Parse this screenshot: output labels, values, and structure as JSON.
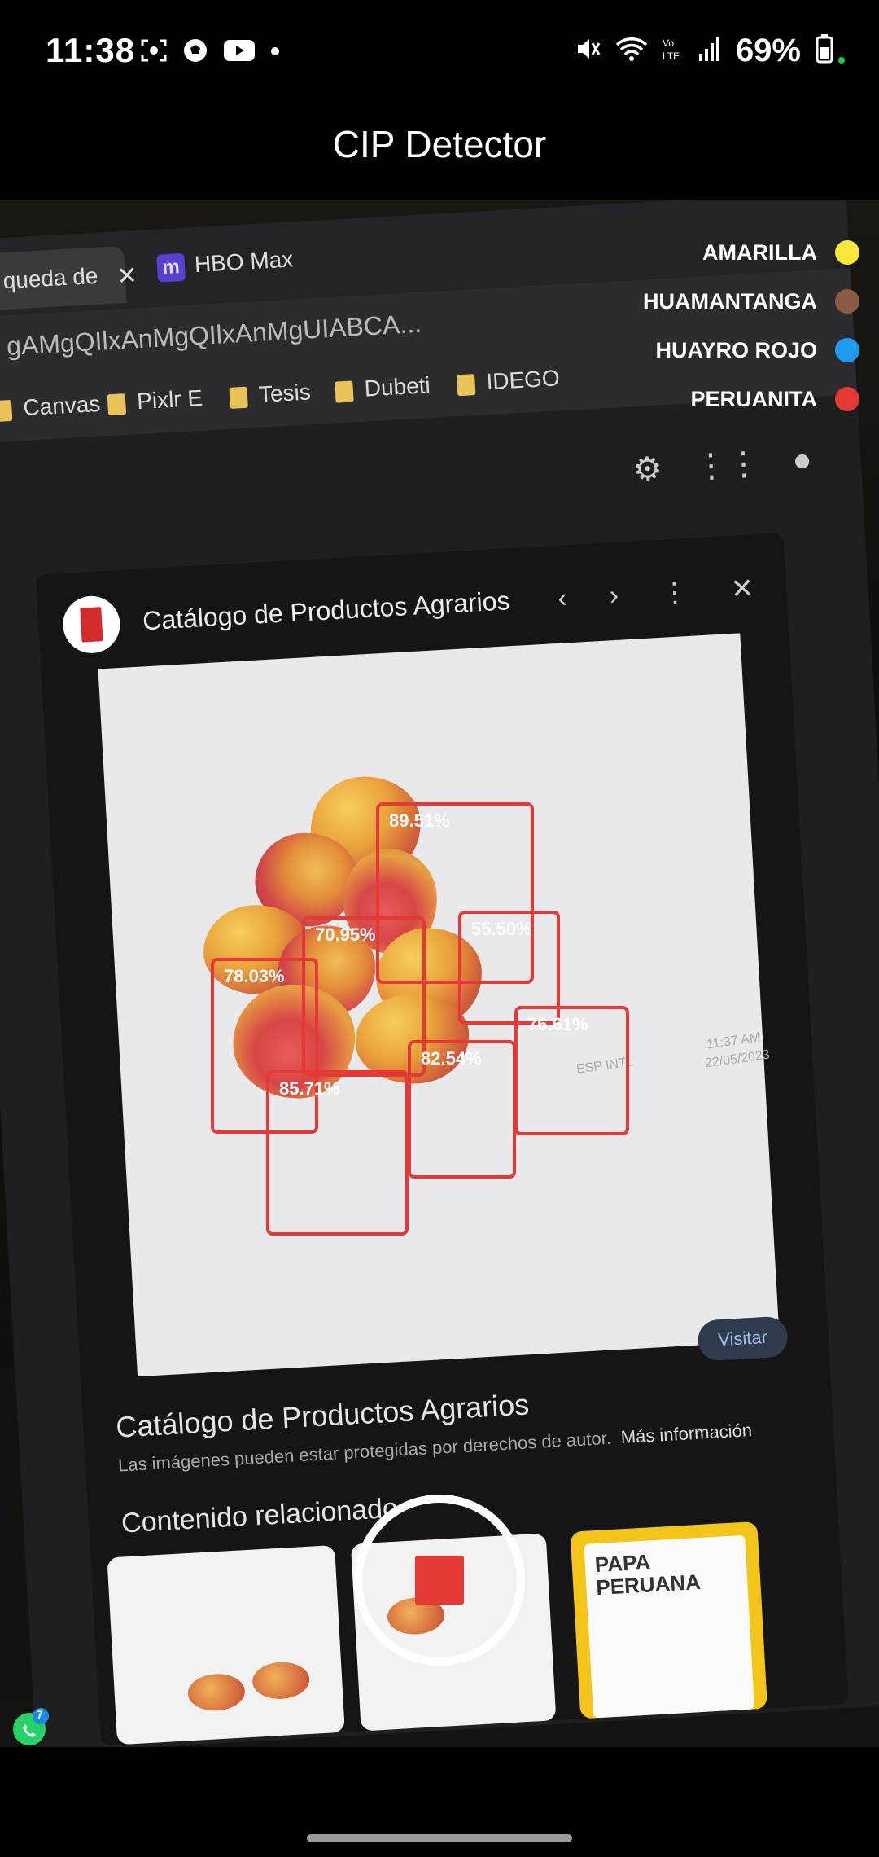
{
  "status_bar": {
    "time": "11:38",
    "battery": "69%",
    "left_icons": [
      "screen-record-icon",
      "soccer-ball-icon",
      "youtube-icon",
      "dot-icon"
    ],
    "right_icons": [
      "mute-icon",
      "wifi-icon",
      "volte-icon",
      "signal-icon",
      "battery-icon"
    ]
  },
  "app": {
    "title": "CIP Detector"
  },
  "legend": [
    {
      "label": "AMARILLA",
      "color": "#fbe73a"
    },
    {
      "label": "HUAMANTANGA",
      "color": "#8a5a44"
    },
    {
      "label": "HUAYRO ROJO",
      "color": "#1e9bf0"
    },
    {
      "label": "PERUANITA",
      "color": "#e53935"
    }
  ],
  "detections": [
    {
      "confidence": "89.51%",
      "class": "PERUANITA"
    },
    {
      "confidence": "70.95%",
      "class": "PERUANITA"
    },
    {
      "confidence": "55.50%",
      "class": "PERUANITA"
    },
    {
      "confidence": "78.03%",
      "class": "PERUANITA"
    },
    {
      "confidence": "76.61%",
      "class": "PERUANITA"
    },
    {
      "confidence": "82.54%",
      "class": "PERUANITA"
    },
    {
      "confidence": "85.71%",
      "class": "PERUANITA"
    }
  ],
  "screen_content": {
    "tab_active": "queda de",
    "tab_hbo": "HBO Max",
    "url": "gAMgQIlxAnMgQIlxAnMgUIABCA...",
    "bookmarks": [
      "Canvas",
      "Pixlr E",
      "Tesis",
      "Dubeti",
      "IDEGO"
    ],
    "panel_title": "Catálogo de Productos Agrarios",
    "image_caption": "Catálogo de Productos Agrarios",
    "image_sub": "Las imágenes pueden estar protegidas por derechos de autor.",
    "image_sub_link": "Más información",
    "visit_button": "Visitar",
    "related_title": "Contenido relacionado",
    "related_card_text": "PAPA PERUANA",
    "taskbar_lang": "ESP INTL",
    "taskbar_time": "11:37 AM",
    "taskbar_date": "22/05/2023",
    "whatsapp_badge": "7"
  },
  "controls": {
    "record_state": "recording"
  }
}
